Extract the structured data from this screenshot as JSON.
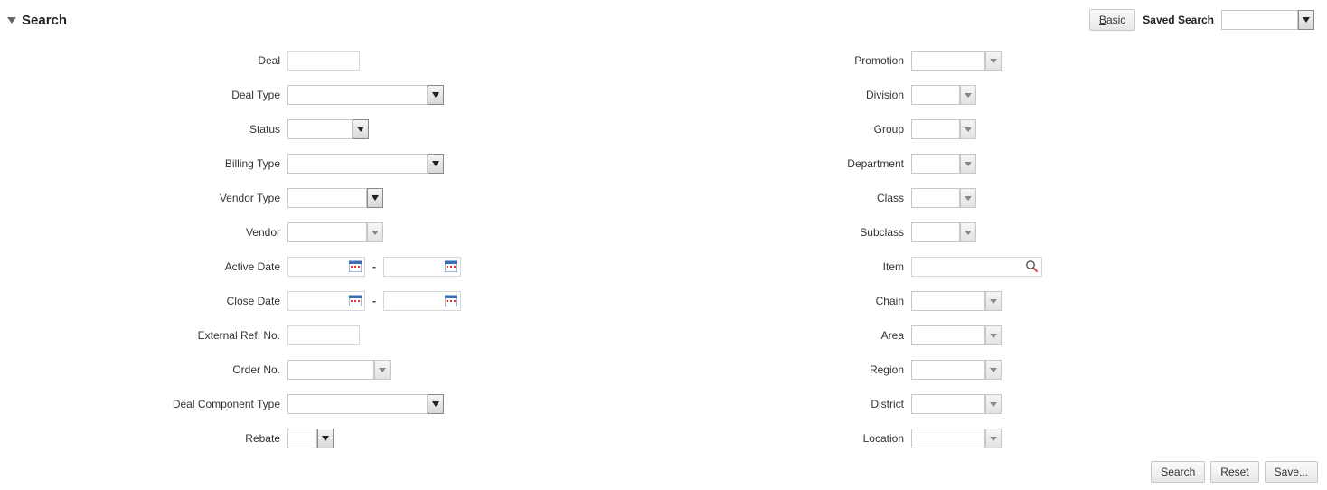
{
  "header": {
    "title": "Search",
    "basic_label_prefix": "B",
    "basic_label_suffix": "asic",
    "saved_search_label": "Saved Search",
    "saved_search_value": ""
  },
  "left_fields": {
    "deal": {
      "label": "Deal",
      "value": ""
    },
    "deal_type": {
      "label": "Deal Type",
      "value": ""
    },
    "status": {
      "label": "Status",
      "value": ""
    },
    "billing_type": {
      "label": "Billing Type",
      "value": ""
    },
    "vendor_type": {
      "label": "Vendor Type",
      "value": ""
    },
    "vendor": {
      "label": "Vendor",
      "value": ""
    },
    "active_date": {
      "label": "Active Date",
      "from": "",
      "to": ""
    },
    "close_date": {
      "label": "Close Date",
      "from": "",
      "to": ""
    },
    "external_ref": {
      "label": "External Ref. No.",
      "value": ""
    },
    "order_no": {
      "label": "Order No.",
      "value": ""
    },
    "deal_component_type": {
      "label": "Deal Component Type",
      "value": ""
    },
    "rebate": {
      "label": "Rebate",
      "value": ""
    }
  },
  "right_fields": {
    "promotion": {
      "label": "Promotion",
      "value": ""
    },
    "division": {
      "label": "Division",
      "value": ""
    },
    "group": {
      "label": "Group",
      "value": ""
    },
    "department": {
      "label": "Department",
      "value": ""
    },
    "class": {
      "label": "Class",
      "value": ""
    },
    "subclass": {
      "label": "Subclass",
      "value": ""
    },
    "item": {
      "label": "Item",
      "value": ""
    },
    "chain": {
      "label": "Chain",
      "value": ""
    },
    "area": {
      "label": "Area",
      "value": ""
    },
    "region": {
      "label": "Region",
      "value": ""
    },
    "district": {
      "label": "District",
      "value": ""
    },
    "location": {
      "label": "Location",
      "value": ""
    }
  },
  "footer": {
    "search": "Search",
    "reset": "Reset",
    "save": "Save..."
  },
  "sep": "-"
}
